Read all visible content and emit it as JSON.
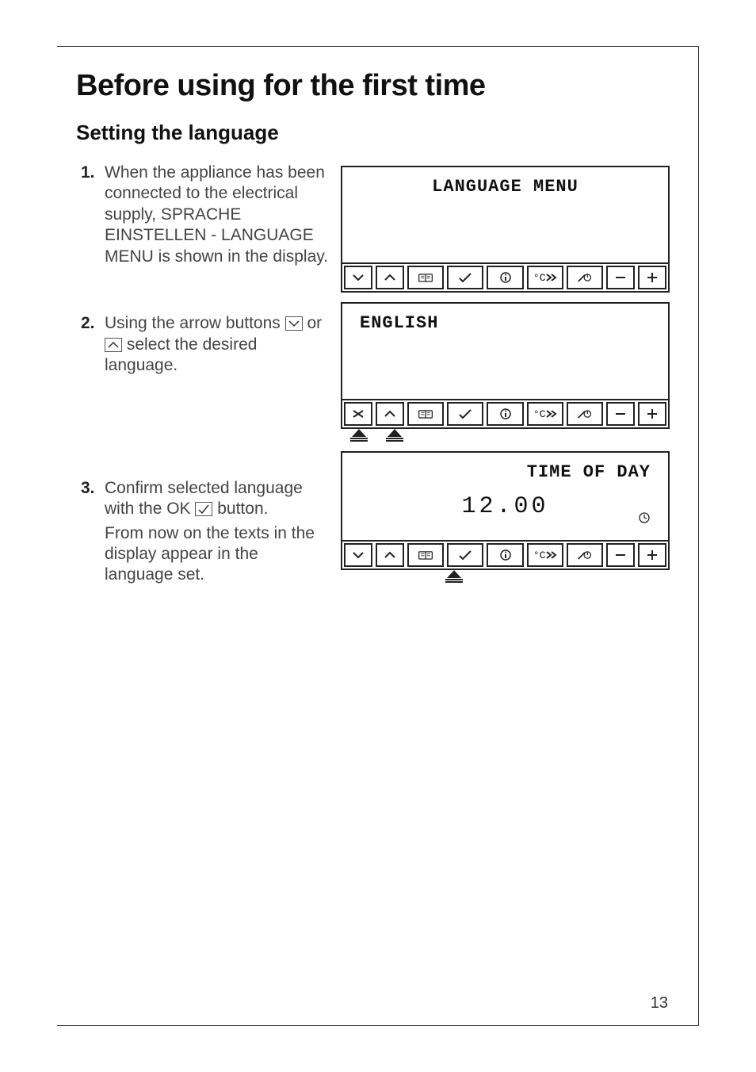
{
  "page": {
    "title": "Before using for the first time",
    "subtitle": "Setting the language",
    "number": "13"
  },
  "steps": [
    {
      "num": "1.",
      "text_a": "When the appliance has been connected to the electrical supply, SPRACHE EINSTELLEN - LANGUAGE MENU is shown in the display."
    },
    {
      "num": "2.",
      "text_a": "Using the arrow buttons ",
      "text_b": " or ",
      "text_c": " select the desired language."
    },
    {
      "num": "3.",
      "text_a": "Confirm selected language with the OK ",
      "text_b": " button.",
      "text_c": "From now on the texts in the display appear in the language set."
    }
  ],
  "lcd": {
    "panel1": {
      "title": "LANGUAGE MENU"
    },
    "panel2": {
      "title": "ENGLISH"
    },
    "panel3": {
      "title": "TIME OF DAY",
      "time": "12.00"
    }
  },
  "buttons": {
    "down": "v",
    "up": "^",
    "recipe": "recipe",
    "ok": "ok",
    "info": "i",
    "rapid": "°C»",
    "probe": "probe",
    "minus": "−",
    "plus": "+"
  }
}
